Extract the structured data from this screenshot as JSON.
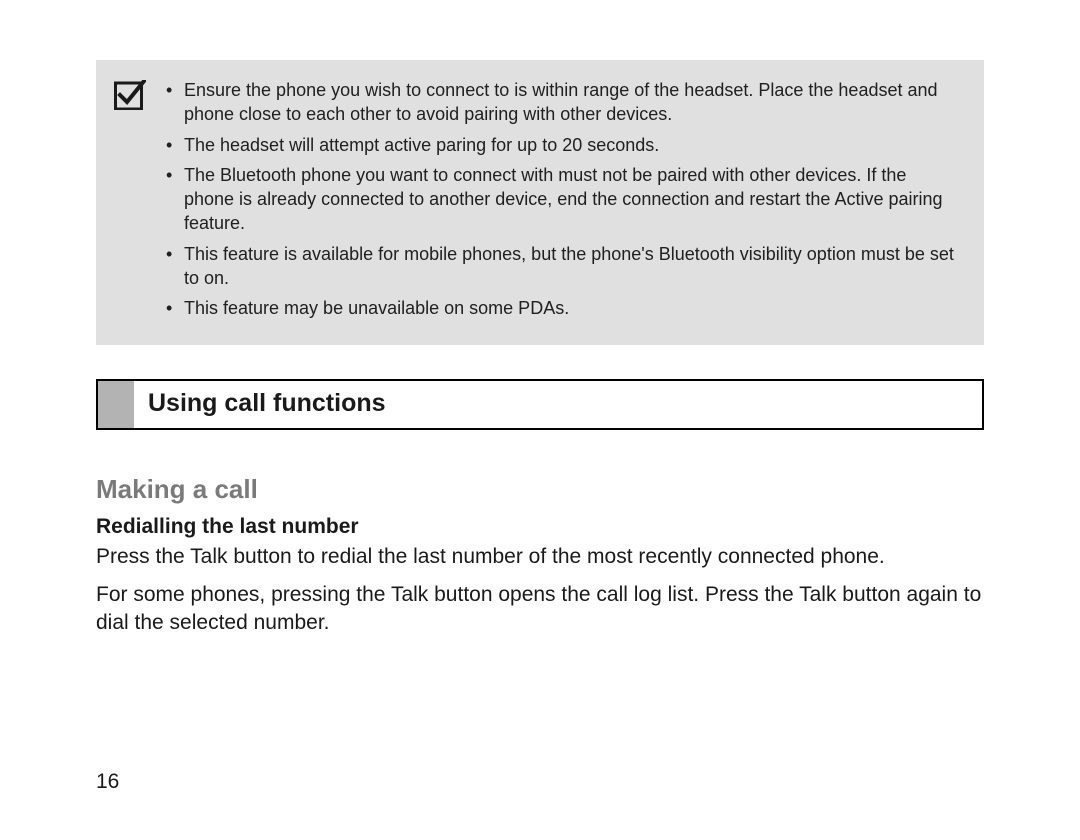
{
  "note": {
    "bullets": [
      "Ensure the phone you wish to connect to is within range of the headset. Place the headset and phone close to each other to avoid pairing with other devices.",
      "The headset will attempt active paring for up to 20 seconds.",
      "The Bluetooth phone you want to connect with must not be paired with other devices. If the phone is already connected to another device, end the connection and restart the Active pairing feature.",
      "This feature is available for mobile phones, but the phone's Bluetooth visibility option must be set to on.",
      "This feature may be unavailable on some PDAs."
    ]
  },
  "section_heading": "Using call functions",
  "subheading": "Making a call",
  "subsubheading": "Redialling the last number",
  "paragraphs": [
    "Press the Talk button to redial the last number of the most recently connected phone.",
    "For some phones, pressing the Talk button opens the call log list. Press the Talk button again to dial the selected number."
  ],
  "page_number": "16"
}
